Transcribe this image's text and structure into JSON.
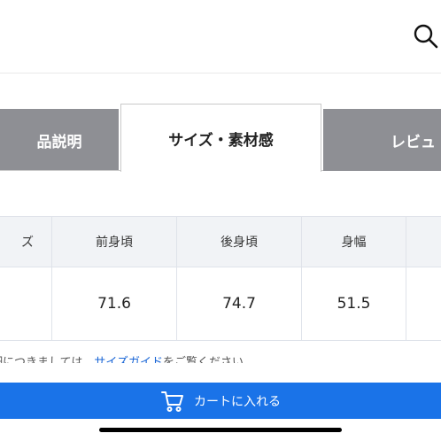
{
  "header": {
    "search_icon": "search-icon"
  },
  "tabs": [
    {
      "label": "品説明",
      "active": false
    },
    {
      "label": "サイズ・素材感",
      "active": true
    },
    {
      "label": "レビュ",
      "active": false
    }
  ],
  "size_table": {
    "headers": [
      "ズ",
      "前身頃",
      "後身頃",
      "身幅"
    ],
    "values": [
      "",
      "71.6",
      "74.7",
      "51.5"
    ]
  },
  "note": {
    "prefix": "細につきましては、",
    "link": "サイズガイド",
    "suffix": "をご覧ください"
  },
  "cart_button": {
    "label": "カートに入れる",
    "icon": "cart-icon"
  },
  "colors": {
    "accent": "#1a73e8",
    "tab_inactive": "#8e8f94",
    "table_header_bg": "#f1f3f6",
    "link": "#1a66d6"
  }
}
